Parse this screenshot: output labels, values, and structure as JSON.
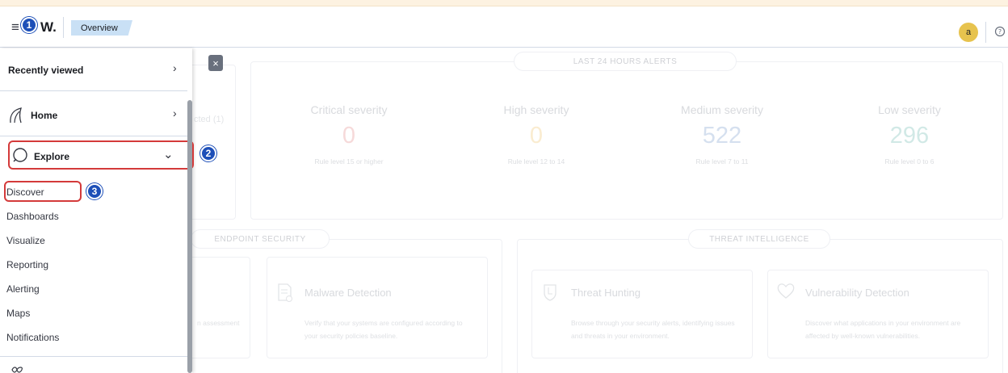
{
  "header": {
    "logo": "W.",
    "breadcrumb": "Overview",
    "avatar": "a",
    "menu_icon": "hamburger-menu-icon",
    "help_icon": "help-icon"
  },
  "steps": [
    "1",
    "2",
    "3"
  ],
  "nav": {
    "recently_viewed": "Recently viewed",
    "home": "Home",
    "explore": "Explore",
    "items": [
      "Discover",
      "Dashboards",
      "Visualize",
      "Reporting",
      "Alerting",
      "Maps",
      "Notifications"
    ],
    "chevron_right": "›",
    "chevron_down": "⌄",
    "close": "×"
  },
  "alerts": {
    "title": "LAST 24 HOURS ALERTS",
    "partial_label": "cted (1)",
    "severities": [
      {
        "title": "Critical severity",
        "value": "0",
        "sub": "Rule level 15 or higher",
        "color": "#f2c6c6"
      },
      {
        "title": "High severity",
        "value": "0",
        "sub": "Rule level 12 to 14",
        "color": "#f7e2b7"
      },
      {
        "title": "Medium severity",
        "value": "522",
        "sub": "Rule level 7 to 11",
        "color": "#bfcfe6"
      },
      {
        "title": "Low severity",
        "value": "296",
        "sub": "Rule level 0 to 6",
        "color": "#b9ddd9"
      }
    ]
  },
  "endpoint": {
    "title": "ENDPOINT SECURITY",
    "partial_desc": "n assessment",
    "malware": {
      "title": "Malware Detection",
      "desc": [
        "Verify that your systems are configured according to",
        "your security policies baseline."
      ]
    }
  },
  "threat": {
    "title": "THREAT INTELLIGENCE",
    "hunting": {
      "title": "Threat Hunting",
      "desc": [
        "Browse through your security alerts, identifying issues",
        "and threats in your environment."
      ]
    },
    "vuln": {
      "title": "Vulnerability Detection",
      "desc": [
        "Discover what applications in your environment are",
        "affected by well-known vulnerabilities."
      ]
    }
  }
}
